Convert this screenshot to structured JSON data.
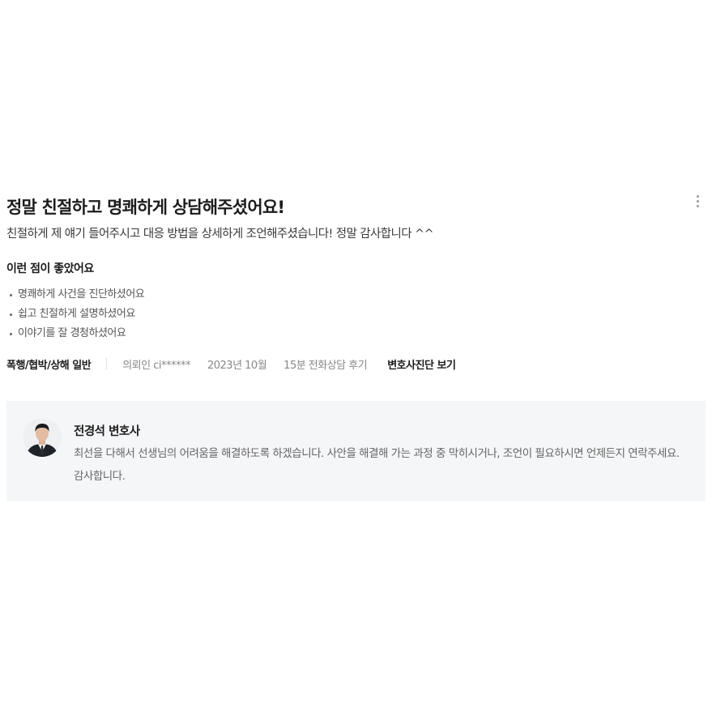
{
  "review": {
    "title": "정말 친절하고 명쾌하게 상담해주셨어요!",
    "body": "친절하게 제 얘기 들어주시고 대응 방법을 상세하게 조언해주셨습니다! 정말 감사합니다 ^^",
    "good_points_title": "이런 점이 좋았어요",
    "good_points": [
      "명쾌하게 사건을 진단하셨어요",
      "쉽고 친절하게 설명하셨어요",
      "이야기를 잘 경청하셨어요"
    ],
    "category": "폭행/협박/상해 일반",
    "client": "의뢰인 ci******",
    "date": "2023년 10월",
    "consult_type": "15분 전화상담 후기",
    "diagnosis_link": "변호사진단 보기",
    "more_icon": "more-vertical-icon"
  },
  "reply": {
    "lawyer_name": "전경석 변호사",
    "text": "최선을 다해서 선생님의 어려움을 해결하도록 하겠습니다. 사안을 해결해 가는 과정 중 막히시거나, 조언이 필요하시면 언제든지 연락주세요. 감사합니다.",
    "avatar_icon": "lawyer-avatar",
    "background_color": "#f5f6f8"
  },
  "colors": {
    "highlight": "#ffd23c",
    "title": "#1c1c1c",
    "muted": "#888888"
  }
}
